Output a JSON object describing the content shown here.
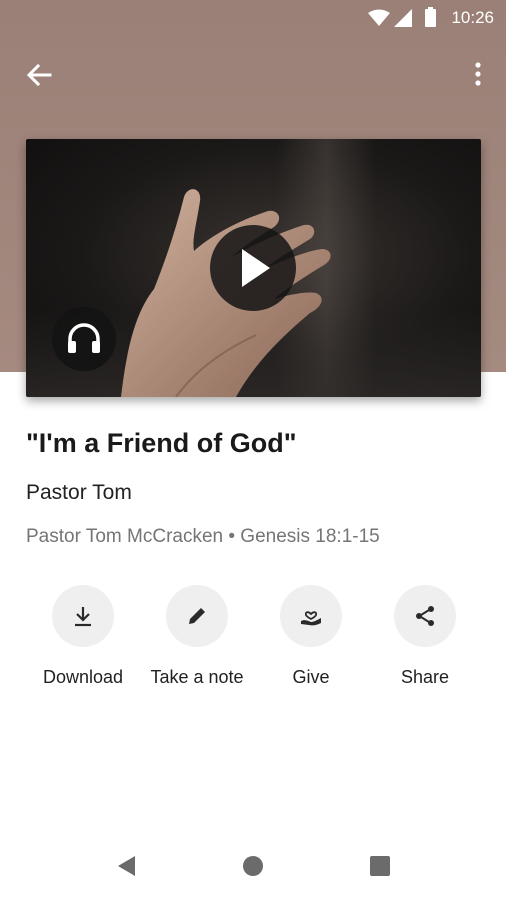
{
  "status_bar": {
    "time": "10:26"
  },
  "header": {
    "back_icon": "arrow-left-icon",
    "menu_icon": "more-vertical-icon"
  },
  "media": {
    "play_icon": "play-icon",
    "audio_icon": "headphones-icon"
  },
  "sermon": {
    "title": "\"I'm a Friend of God\"",
    "speaker": "Pastor Tom",
    "meta": "Pastor Tom McCracken • Genesis 18:1-15"
  },
  "actions": [
    {
      "label": "Download",
      "icon": "download-icon"
    },
    {
      "label": "Take a note",
      "icon": "pencil-icon"
    },
    {
      "label": "Give",
      "icon": "give-heart-hand-icon"
    },
    {
      "label": "Share",
      "icon": "share-icon"
    }
  ],
  "nav": {
    "back": "nav-back-icon",
    "home": "nav-home-icon",
    "recent": "nav-recent-icon"
  }
}
